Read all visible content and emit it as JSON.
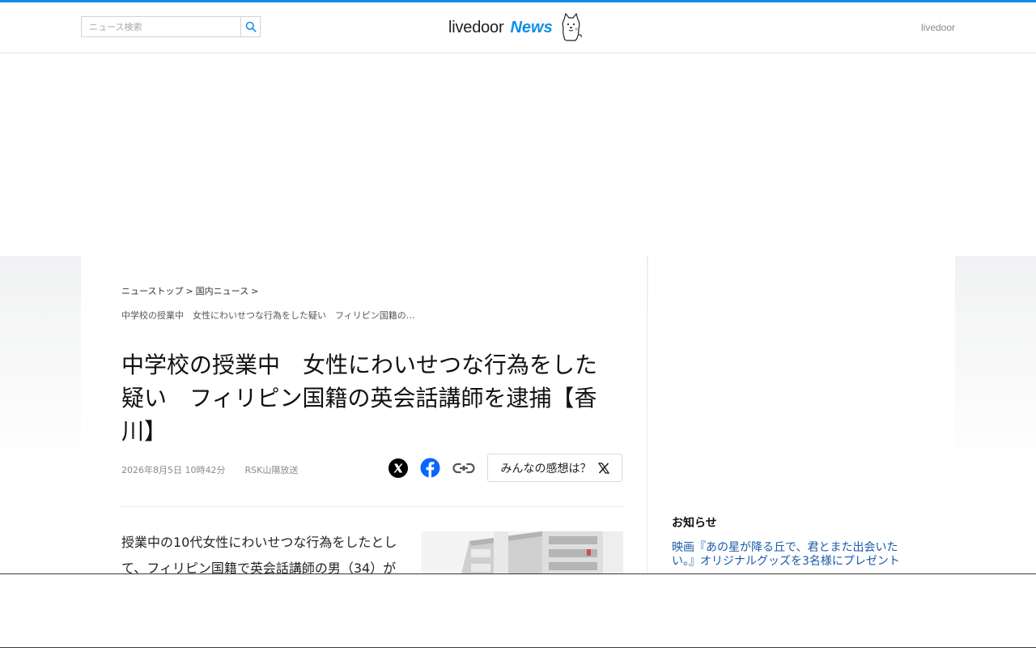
{
  "header": {
    "search_placeholder": "ニュース検索",
    "logo_text": "livedoor",
    "logo_news": "News",
    "right_link": "livedoor"
  },
  "colors": {
    "accent": "#0d8fe8",
    "link": "#1a5aa8"
  },
  "breadcrumb": {
    "items": [
      "ニューストップ",
      "国内ニュース"
    ],
    "separator": ">",
    "current": "中学校の授業中　女性にわいせつな行為をした疑い　フィリピン国籍の…"
  },
  "article": {
    "title": "中学校の授業中　女性にわいせつな行為をした疑い　フィリピン国籍の英会話講師を逮捕【香川】",
    "date": "2026年8月5日 10時42分",
    "source": "RSK山陽放送",
    "feel_button": "みんなの感想は？",
    "body": "授業中の10代女性にわいせつな行為をしたとして、フィリピン国籍で英会話講師の男（34）が"
  },
  "share_icons": [
    "x-icon",
    "facebook-icon",
    "link-icon"
  ],
  "sidebar": {
    "notice_title": "お知らせ",
    "notice_link": "映画『あの星が降る丘で、君とまた出会いたい。』オリジナルグッズを3名様にプレゼント"
  }
}
